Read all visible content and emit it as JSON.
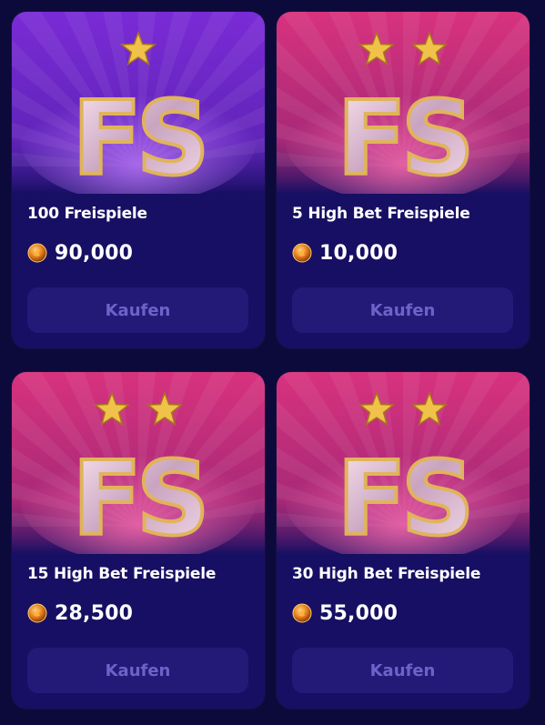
{
  "colors": {
    "page_background": "#0c0a3a",
    "card_background": "#170f63",
    "button_background": "#231a78",
    "button_text": "#6f61c9",
    "art_purple": "#7a2bd6",
    "art_pink": "#d8327e",
    "gold": "#f0c24a"
  },
  "offers": [
    {
      "title": "100 Freispiele",
      "price": "90,000",
      "button_label": "Kaufen",
      "stars": 1,
      "theme": "purple",
      "art_letters": "FS"
    },
    {
      "title": "5 High Bet Freispiele",
      "price": "10,000",
      "button_label": "Kaufen",
      "stars": 2,
      "theme": "pink",
      "art_letters": "FS"
    },
    {
      "title": "15 High Bet Freispiele",
      "price": "28,500",
      "button_label": "Kaufen",
      "stars": 2,
      "theme": "pink",
      "art_letters": "FS"
    },
    {
      "title": "30 High Bet Freispiele",
      "price": "55,000",
      "button_label": "Kaufen",
      "stars": 2,
      "theme": "pink",
      "art_letters": "FS"
    }
  ]
}
